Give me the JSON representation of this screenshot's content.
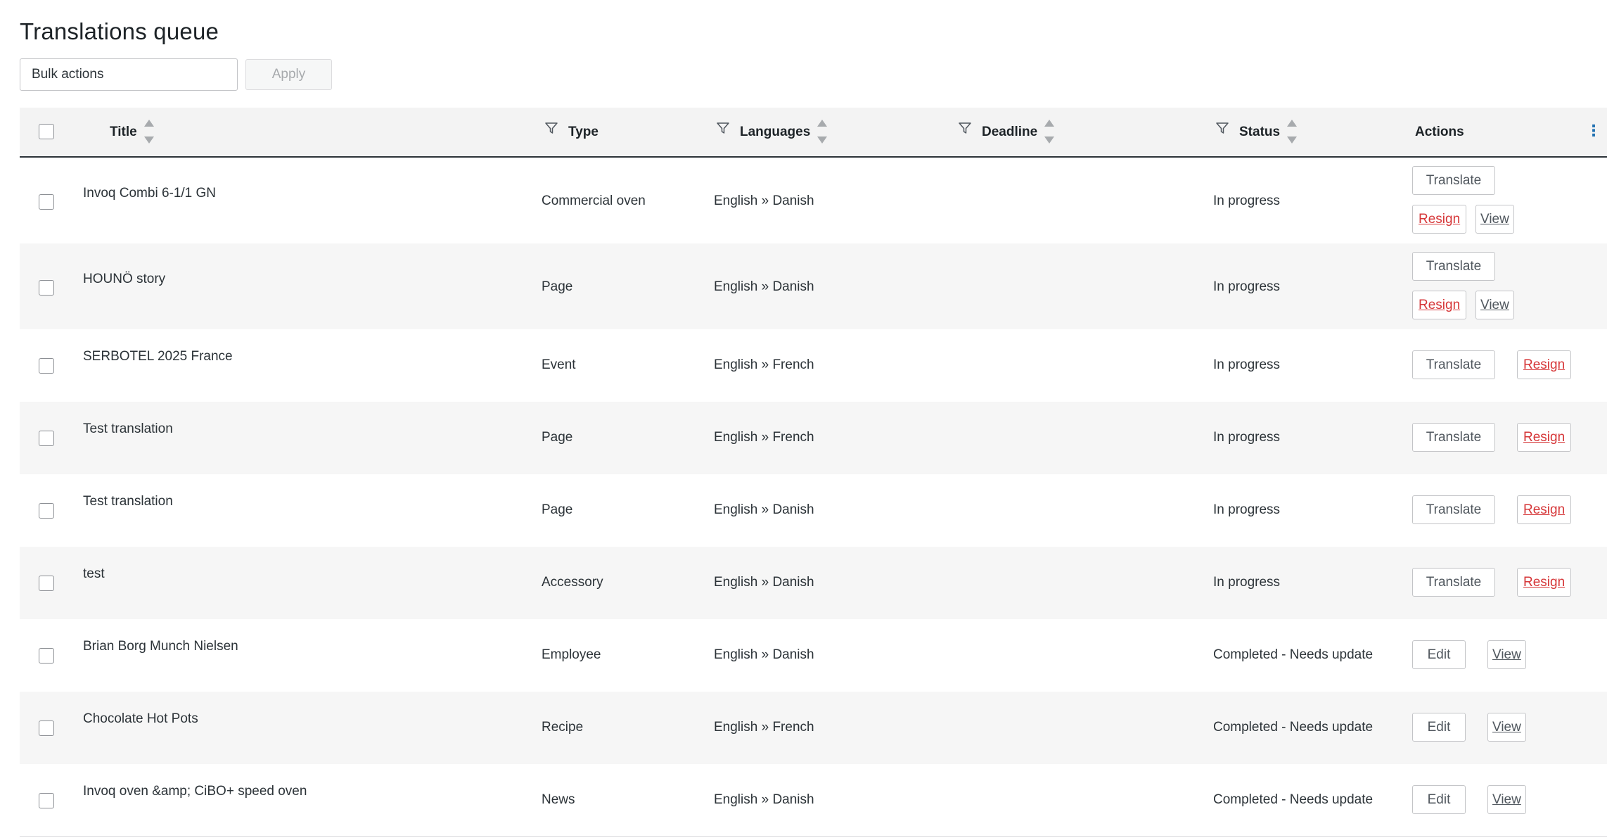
{
  "page": {
    "title": "Translations queue"
  },
  "bulk": {
    "select_value": "Bulk actions",
    "apply_label": "Apply"
  },
  "columns": {
    "title": "Title",
    "type": "Type",
    "languages": "Languages",
    "deadline": "Deadline",
    "status": "Status",
    "actions": "Actions"
  },
  "rows": [
    {
      "title": "Invoq Combi 6-1/1 GN",
      "type": "Commercial oven",
      "languages": "English » Danish",
      "deadline": "",
      "status": "In progress",
      "actions": {
        "translate": "Translate",
        "resign": "Resign",
        "view": "View"
      }
    },
    {
      "title": "HOUNÖ story",
      "type": "Page",
      "languages": "English » Danish",
      "deadline": "",
      "status": "In progress",
      "actions": {
        "translate": "Translate",
        "resign": "Resign",
        "view": "View"
      }
    },
    {
      "title": "SERBOTEL 2025 France",
      "type": "Event",
      "languages": "English » French",
      "deadline": "",
      "status": "In progress",
      "actions": {
        "translate": "Translate",
        "resign": "Resign"
      }
    },
    {
      "title": "Test translation",
      "type": "Page",
      "languages": "English » French",
      "deadline": "",
      "status": "In progress",
      "actions": {
        "translate": "Translate",
        "resign": "Resign"
      }
    },
    {
      "title": "Test translation",
      "type": "Page",
      "languages": "English » Danish",
      "deadline": "",
      "status": "In progress",
      "actions": {
        "translate": "Translate",
        "resign": "Resign"
      }
    },
    {
      "title": "test",
      "type": "Accessory",
      "languages": "English » Danish",
      "deadline": "",
      "status": "In progress",
      "actions": {
        "translate": "Translate",
        "resign": "Resign"
      }
    },
    {
      "title": "Brian Borg Munch Nielsen",
      "type": "Employee",
      "languages": "English » Danish",
      "deadline": "",
      "status": "Completed - Needs update",
      "actions": {
        "edit": "Edit",
        "view": "View"
      }
    },
    {
      "title": "Chocolate Hot Pots",
      "type": "Recipe",
      "languages": "English » French",
      "deadline": "",
      "status": "Completed - Needs update",
      "actions": {
        "edit": "Edit",
        "view": "View"
      }
    },
    {
      "title": "Invoq oven &amp; CiBO+ speed oven",
      "type": "News",
      "languages": "English » Danish",
      "deadline": "",
      "status": "Completed - Needs update",
      "actions": {
        "edit": "Edit",
        "view": "View"
      }
    }
  ],
  "colors": {
    "header_bg": "#f3f3f3",
    "alt_row_bg": "#f6f6f6",
    "resign_link": "#d63638",
    "kebab": "#2271b1"
  },
  "icons": {
    "filter": "filter-icon",
    "sort": "sort-arrows-icon",
    "more": "kebab-menu-icon"
  }
}
